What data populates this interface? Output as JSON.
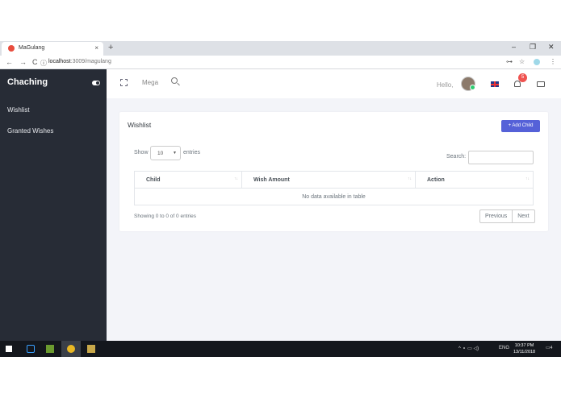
{
  "browser": {
    "tab_title": "MaGulang",
    "tab_close": "×",
    "new_tab": "+",
    "url_host": "localhost",
    "url_path": ":3009/magulang",
    "back": "←",
    "forward": "→",
    "reload": "C",
    "info": "ⓘ",
    "minimize": "–",
    "restore": "❐",
    "close": "✕",
    "key_icon": "⊶",
    "star": "☆",
    "menu": "⋮"
  },
  "sidebar": {
    "brand": "Chaching",
    "items": [
      {
        "label": "Wishlist"
      },
      {
        "label": "Granted Wishes"
      }
    ]
  },
  "header": {
    "mega": "Mega",
    "hello": "Hello,",
    "notification_count": "5"
  },
  "card": {
    "title": "Wishlist",
    "add_button": "+ Add Child",
    "show_label": "Show",
    "show_value": "10",
    "entries_label": "entries",
    "search_label": "Search:",
    "columns": [
      "Child",
      "Wish Amount",
      "Action"
    ],
    "empty_message": "No data available in table",
    "info": "Showing 0 to 0 of 0 entries",
    "prev": "Previous",
    "next": "Next"
  },
  "taskbar": {
    "tray_text": "^ ⚬ ▭ ◁)",
    "lang": "ENG",
    "time": "10:37 PM",
    "date": "13/11/2018",
    "notification": "4"
  }
}
